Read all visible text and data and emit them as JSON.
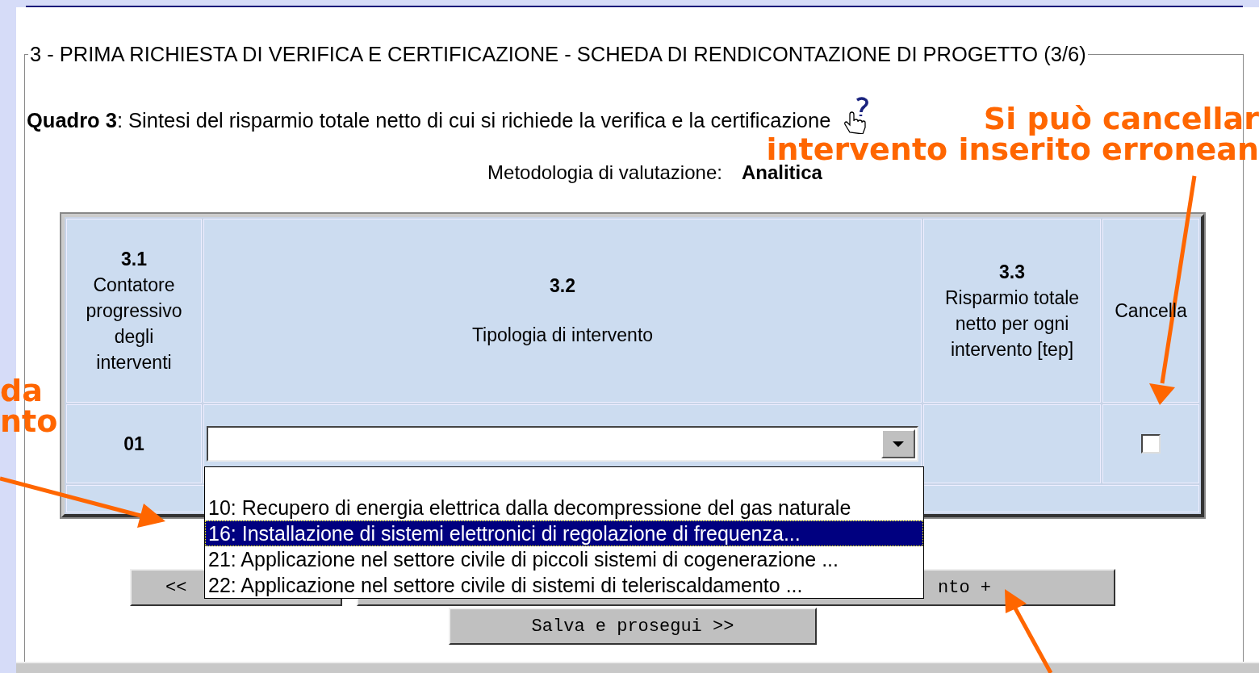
{
  "fieldset": {
    "legend": "3 - PRIMA RICHIESTA DI VERIFICA E CERTIFICAZIONE - SCHEDA DI RENDICONTAZIONE DI PROGETTO (3/6)"
  },
  "quadro": {
    "text": "**Quadro 3**: Sintesi del risparmio totale netto di cui si richiede la verifica e la certificazione"
  },
  "methodology": {
    "label": "Metodologia di valutazione:",
    "value": "Analitica"
  },
  "table": {
    "columns": [
      {
        "number": "3.1",
        "title_lines": [
          "Contatore",
          "progressivo",
          "degli",
          "interventi"
        ]
      },
      {
        "number": "3.2",
        "title_lines": [
          "Tipologia di intervento"
        ]
      },
      {
        "number": "3.3",
        "title_lines": [
          "Risparmio totale",
          "netto per ogni",
          "intervento [tep]"
        ]
      },
      {
        "title_lines": [
          "Cancella"
        ]
      }
    ],
    "rows": [
      {
        "counter": "01",
        "delete_checked": false
      }
    ]
  },
  "dropdown": {
    "expanded": true,
    "options": [
      {
        "label": "10: Recupero di energia elettrica dalla decompressione del gas naturale",
        "selected": false
      },
      {
        "label": "16: Installazione di sistemi elettronici di regolazione di frequenza...",
        "selected": true
      },
      {
        "label": "21: Applicazione nel settore civile di piccoli sistemi di cogenerazione ...",
        "selected": false
      },
      {
        "label": "22: Applicazione nel settore civile di sistemi di teleriscaldamento ...",
        "selected": false
      }
    ]
  },
  "buttons": [
    {
      "label": "<<"
    },
    {
      "label": "nto +"
    },
    {
      "label": "Salva e prosegui >>"
    }
  ],
  "annotations": [
    {
      "kind": "right",
      "lines": [
        "Si può cancellar",
        "intervento inserito erronean"
      ]
    },
    {
      "kind": "left",
      "lines": [
        "da",
        "nto"
      ]
    }
  ]
}
